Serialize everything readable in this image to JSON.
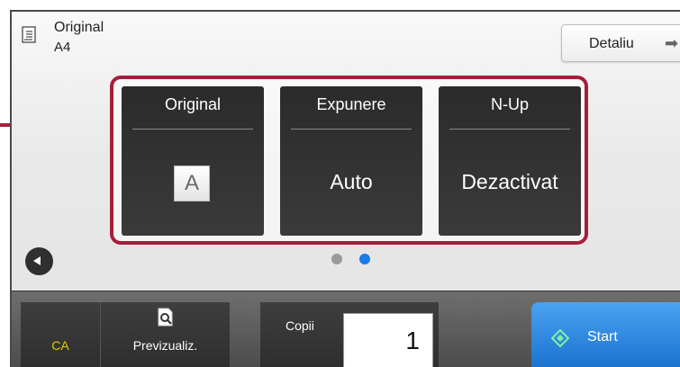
{
  "header": {
    "original_label": "Original",
    "original_size": "A4",
    "detail_button": "Detaliu",
    "detail_arrow": "➡"
  },
  "tiles": [
    {
      "title": "Original",
      "value": "A",
      "value_type": "orientation-icon"
    },
    {
      "title": "Expunere",
      "value": "Auto"
    },
    {
      "title": "N-Up",
      "value": "Dezactivat"
    }
  ],
  "pager": {
    "pages": 2,
    "current_page": 2
  },
  "bottom": {
    "ca_label": "CA",
    "preview_label": "Previzualiz.",
    "copies_label": "Copii",
    "copies_value": "1",
    "start_label": "Start"
  },
  "colors": {
    "highlight_frame": "#a51f3c",
    "ca_text": "#e3cb00",
    "start_button": "#2d8be6",
    "page_dot_active": "#1b7be8"
  }
}
